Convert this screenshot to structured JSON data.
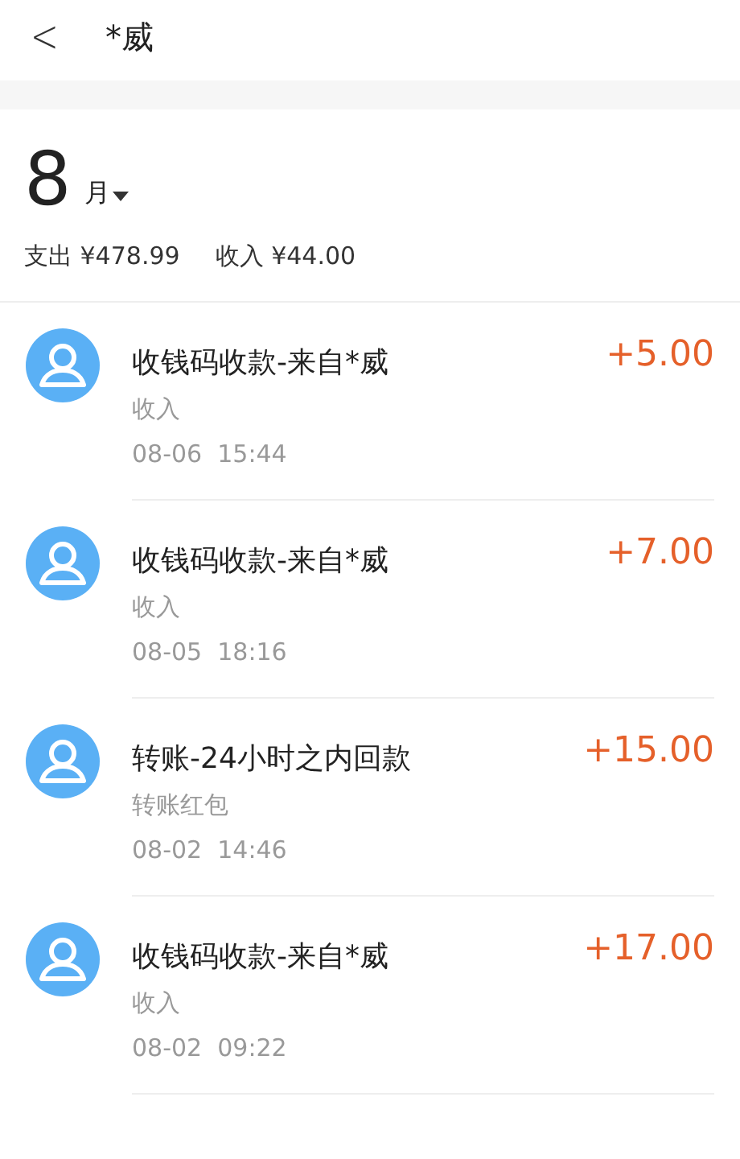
{
  "header": {
    "back": "<",
    "title": "*威"
  },
  "month": {
    "number": "8",
    "unit": "月"
  },
  "summary": [
    {
      "text": "支出 ¥478.99"
    },
    {
      "text": "收入 ¥44.00"
    }
  ],
  "transactions": [
    {
      "title": "收钱码收款-来自*威",
      "category": "收入",
      "time": "08-06  15:44",
      "amount": "+5.00"
    },
    {
      "title": "收钱码收款-来自*威",
      "category": "收入",
      "time": "08-05  18:16",
      "amount": "+7.00"
    },
    {
      "title": "转账-24小时之内回款",
      "category": "转账红包",
      "time": "08-02  14:46",
      "amount": "+15.00"
    },
    {
      "title": "收钱码收款-来自*威",
      "category": "收入",
      "time": "08-02  09:22",
      "amount": "+17.00"
    }
  ]
}
